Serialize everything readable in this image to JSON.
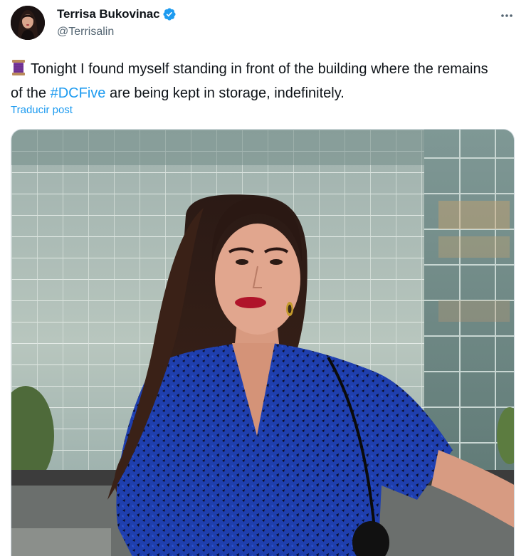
{
  "author": {
    "display_name": "Terrisa Bukovinac",
    "handle": "@Terrisalin",
    "verified": true,
    "avatar_icon": "avatar-photo",
    "verified_icon": "verified-badge-icon",
    "verified_color": "#1d9bf0"
  },
  "tweet": {
    "emoji_icon": "thread-spool-icon",
    "text_before": "Tonight I found myself standing in front of the building where the remains of the ",
    "hashtag": "#DCFive",
    "text_after": " are being kept in storage, indefinitely.",
    "translate_label": "Traducir post"
  },
  "media": {
    "kind": "photo",
    "subject": "photo-woman-in-front-of-glass-building"
  },
  "colors": {
    "link": "#1d9bf0",
    "text": "#0f1419",
    "secondary": "#536471"
  },
  "menu_icon": "more-options-icon"
}
